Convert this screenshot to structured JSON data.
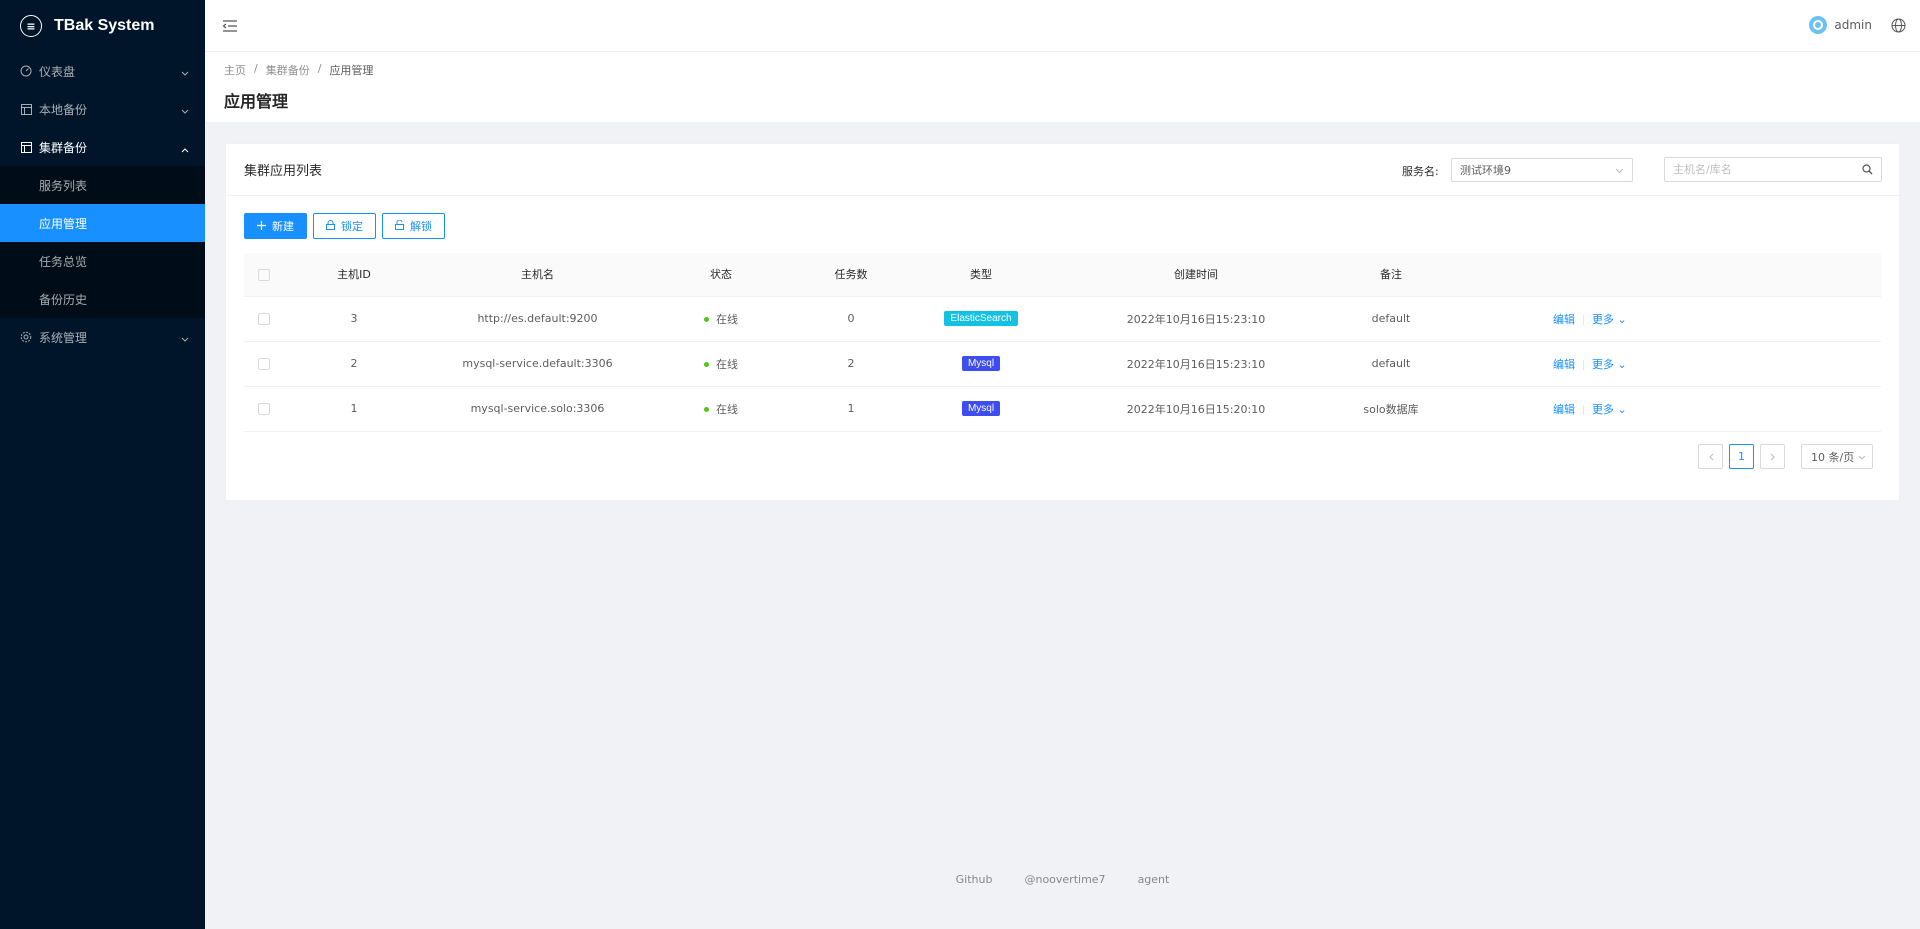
{
  "app": {
    "title": "TBak System",
    "logo_glyph": "≡"
  },
  "sidebar": {
    "items": [
      {
        "label": "仪表盘",
        "icon": "dashboard-icon"
      },
      {
        "label": "本地备份",
        "icon": "table-icon"
      },
      {
        "label": "集群备份",
        "icon": "table-icon",
        "open": true,
        "children": [
          {
            "label": "服务列表"
          },
          {
            "label": "应用管理",
            "active": true
          },
          {
            "label": "任务总览"
          },
          {
            "label": "备份历史"
          }
        ]
      },
      {
        "label": "系统管理",
        "icon": "setting-icon"
      }
    ]
  },
  "header": {
    "user": "admin"
  },
  "breadcrumb": [
    "主页",
    "集群备份",
    "应用管理"
  ],
  "page_title": "应用管理",
  "card": {
    "title": "集群应用列表",
    "service_label": "服务名:",
    "service_value": "测试环境9",
    "search_placeholder": "主机名/库名"
  },
  "toolbar": {
    "new": "新建",
    "lock": "锁定",
    "unlock": "解锁"
  },
  "table": {
    "columns": [
      "主机ID",
      "主机名",
      "状态",
      "任务数",
      "类型",
      "创建时间",
      "备注"
    ],
    "rows": [
      {
        "id": "3",
        "host": "http://es.default:9200",
        "status": "在线",
        "tasks": "0",
        "type": "ElasticSearch",
        "type_color": "#13c2e2",
        "created": "2022年10月16日15:23:10",
        "note": "default",
        "edit": "编辑",
        "more": "更多"
      },
      {
        "id": "2",
        "host": "mysql-service.default:3306",
        "status": "在线",
        "tasks": "2",
        "type": "Mysql",
        "type_color": "#3d4df0",
        "created": "2022年10月16日15:23:10",
        "note": "default",
        "edit": "编辑",
        "more": "更多"
      },
      {
        "id": "1",
        "host": "mysql-service.solo:3306",
        "status": "在线",
        "tasks": "1",
        "type": "Mysql",
        "type_color": "#3d4df0",
        "created": "2022年10月16日15:20:10",
        "note": "solo数据库",
        "edit": "编辑",
        "more": "更多"
      }
    ]
  },
  "pagination": {
    "current": "1",
    "page_size": "10 条/页"
  },
  "footer": [
    "Github",
    "@noovertime7",
    "agent"
  ]
}
